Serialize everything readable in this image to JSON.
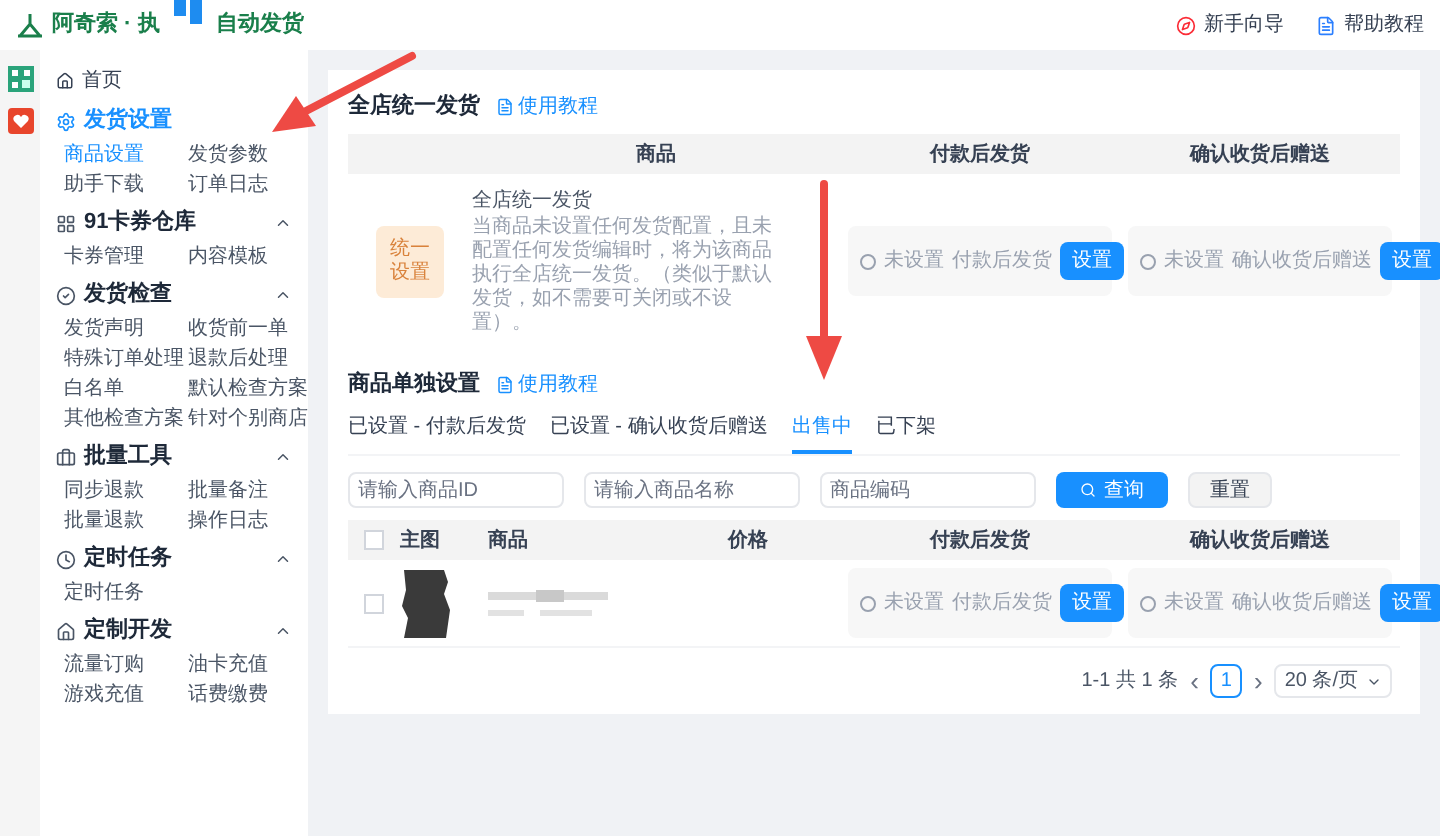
{
  "header": {
    "title_parts": [
      "阿奇索 · 执",
      "自动发货"
    ],
    "links": [
      {
        "label": "新手向导"
      },
      {
        "label": "帮助教程"
      }
    ]
  },
  "sidebar": {
    "home": "首页",
    "groups": [
      {
        "title": "发货设置",
        "selected": true,
        "toggle": false,
        "items": [
          {
            "label": "商品设置",
            "selected": true
          },
          {
            "label": "发货参数",
            "selected": false
          },
          {
            "label": "助手下载",
            "selected": false
          },
          {
            "label": "订单日志",
            "selected": false
          }
        ]
      },
      {
        "title": "91卡券仓库",
        "selected": false,
        "toggle": true,
        "items": [
          {
            "label": "卡券管理",
            "selected": false
          },
          {
            "label": "内容模板",
            "selected": false
          }
        ]
      },
      {
        "title": "发货检查",
        "selected": false,
        "toggle": true,
        "items": [
          {
            "label": "发货声明",
            "selected": false
          },
          {
            "label": "收货前一单",
            "selected": false
          },
          {
            "label": "特殊订单处理",
            "selected": false
          },
          {
            "label": "退款后处理",
            "selected": false
          },
          {
            "label": "白名单",
            "selected": false
          },
          {
            "label": "默认检查方案",
            "selected": false
          },
          {
            "label": "其他检查方案",
            "selected": false
          },
          {
            "label": "针对个别商店",
            "selected": false
          }
        ]
      },
      {
        "title": "批量工具",
        "selected": false,
        "toggle": true,
        "items": [
          {
            "label": "同步退款",
            "selected": false
          },
          {
            "label": "批量备注",
            "selected": false
          },
          {
            "label": "批量退款",
            "selected": false
          },
          {
            "label": "操作日志",
            "selected": false
          }
        ]
      },
      {
        "title": "定时任务",
        "selected": false,
        "toggle": true,
        "items": [
          {
            "label": "定时任务",
            "selected": false
          }
        ]
      },
      {
        "title": "定制开发",
        "selected": false,
        "toggle": true,
        "items": [
          {
            "label": "流量订购",
            "selected": false
          },
          {
            "label": "油卡充值",
            "selected": false
          },
          {
            "label": "游戏充值",
            "selected": false
          },
          {
            "label": "话费缴费",
            "selected": false
          }
        ]
      }
    ]
  },
  "store_wide": {
    "title": "全店统一发货",
    "tutorial": "使用教程",
    "columns": [
      "商品",
      "付款后发货",
      "确认收货后赠送"
    ],
    "row": {
      "badge": "统一设置",
      "name": "全店统一发货",
      "description": "当商品未设置任何发货配置，且未配置任何发货编辑时，将为该商品执行全店统一发货。（类似于默认发货，如不需要可关闭或不设置）。",
      "cells": [
        {
          "status": "未设置",
          "label": "付款后发货",
          "button": "设置"
        },
        {
          "status": "未设置",
          "label": "确认收货后赠送",
          "button": "设置"
        }
      ]
    }
  },
  "per_item": {
    "title": "商品单独设置",
    "tutorial": "使用教程",
    "tabs": [
      {
        "label": "已设置 - 付款后发货",
        "selected": false
      },
      {
        "label": "已设置 - 确认收货后赠送",
        "selected": false
      },
      {
        "label": "出售中",
        "selected": true
      },
      {
        "label": "已下架",
        "selected": false
      }
    ],
    "filters": [
      {
        "placeholder": "请输入商品ID"
      },
      {
        "placeholder": "请输入商品名称"
      },
      {
        "placeholder": "商品编码"
      }
    ],
    "search_button": "查询",
    "reset_button": "重置",
    "select_all": {
      "checked": false
    },
    "columns": [
      "主图",
      "商品",
      "价格",
      "付款后发货",
      "确认收货后赠送"
    ],
    "rows": [
      {
        "checked": false,
        "cells": [
          {
            "kind": "picture"
          },
          {
            "kind": "picture"
          },
          "",
          {
            "kind": "setting",
            "status": "未设置",
            "label": "付款后发货",
            "button": "设置"
          },
          {
            "kind": "setting",
            "status": "未设置",
            "label": "确认收货后赠送",
            "button": "设置"
          }
        ]
      }
    ],
    "pagination": {
      "summary": "1-1 共 1 条",
      "prev": "‹",
      "page": "1",
      "next": "›",
      "page_size": "20 条/页"
    }
  }
}
